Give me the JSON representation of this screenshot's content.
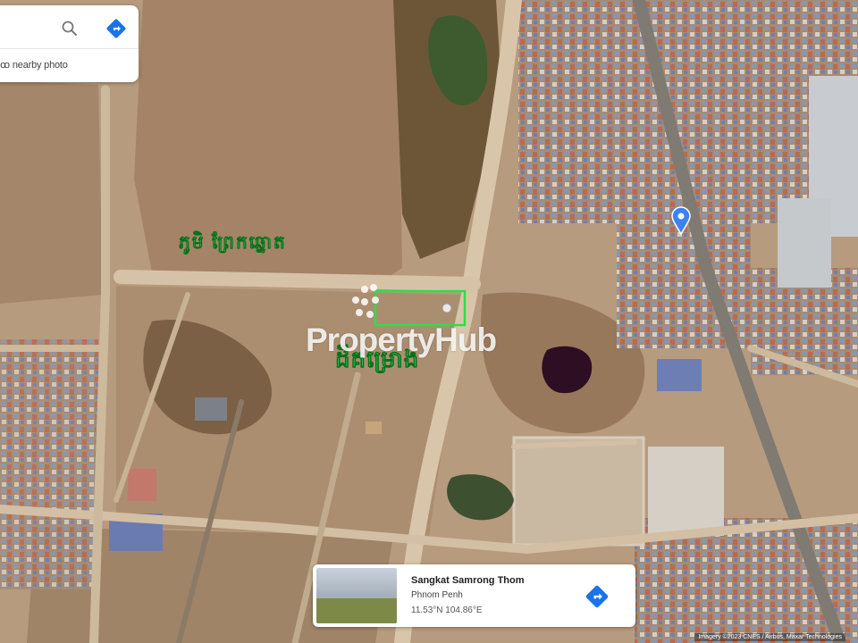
{
  "search_card": {
    "query": "ꝏ︎ nearby photo",
    "search_icon": "search-icon",
    "directions_icon": "directions-icon"
  },
  "map": {
    "type": "satellite",
    "road_label": "ភូមិ ព្រែកឆ្នោត",
    "lot_label": "ដីគម្រោង",
    "pin_icon": "location-pin-icon",
    "highlight_color": "#29e04a",
    "pin_color": "#3b82f6"
  },
  "watermark": {
    "text": "PropertyHub",
    "logo_icon": "propertyhub-logo-icon"
  },
  "place_card": {
    "name": "Sangkat Samrong Thom",
    "region": "Phnom Penh",
    "coordinates": "11.53°N 104.86°E",
    "directions_icon": "directions-icon"
  },
  "attribution": "Imagery ©2023 CNES / Airbus, Maxar Technologies"
}
